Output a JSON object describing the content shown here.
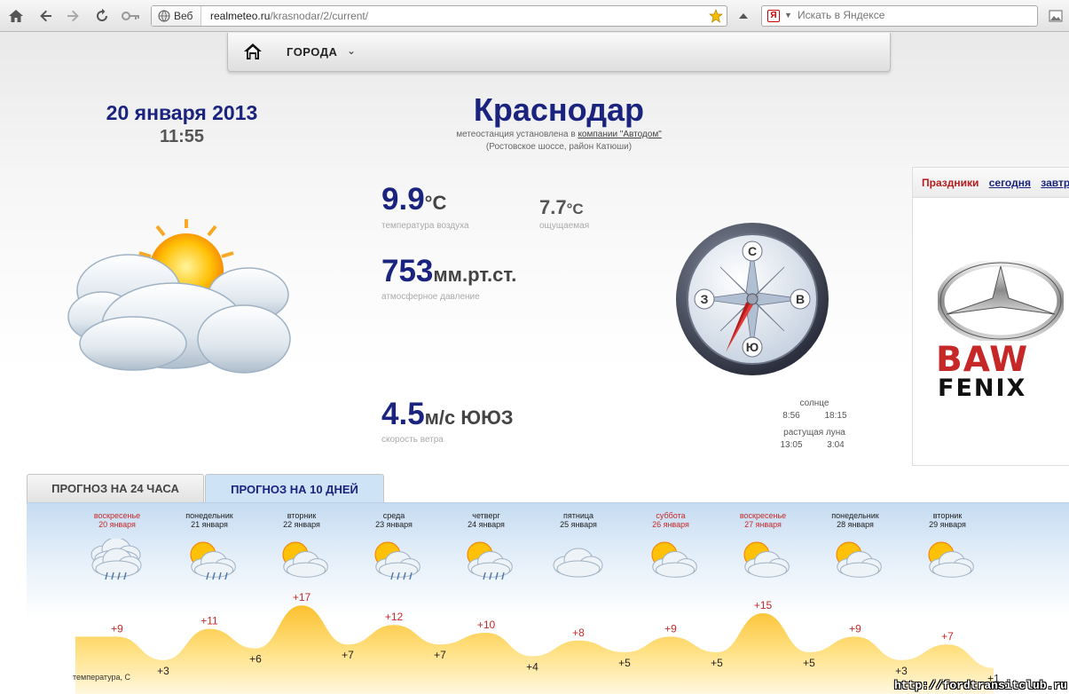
{
  "browser": {
    "identity_label": "Веб",
    "url_host": "realmeteo.ru",
    "url_path": "/krasnodar/2/current/",
    "search_placeholder": "Искать в Яндексе"
  },
  "nav": {
    "cities_label": "ГОРОДА"
  },
  "header": {
    "date": "20 января 2013",
    "time": "11:55",
    "city": "Краснодар",
    "station_prefix": "метеостанция установлена в",
    "station_link": "компании \"Автодом\"",
    "station_address": "(Ростовское шоссе, район Катюши)"
  },
  "current": {
    "temperature": "9.9",
    "temperature_unit": "°С",
    "temperature_caption": "температура воздуха",
    "feels": "7.7",
    "feels_unit": "°С",
    "feels_caption": "ощущаемая",
    "pressure": "753",
    "pressure_unit": "мм.рт.ст.",
    "pressure_caption": "атмосферное давление",
    "wind": "4.5",
    "wind_unit": "м/с ЮЮЗ",
    "wind_caption": "скорость ветра"
  },
  "compass": {
    "north": "С",
    "east": "В",
    "south": "Ю",
    "west": "З"
  },
  "astro": {
    "sun_label": "солнце",
    "sunrise": "8:56",
    "sunset": "18:15",
    "moon_label": "растущая луна",
    "moonrise": "13:05",
    "moonset": "3:04"
  },
  "holidays": {
    "title": "Праздники",
    "today_link": "сегодня",
    "tomorrow_link": "завтра"
  },
  "ad": {
    "brand": "BAW",
    "model": "FENIX"
  },
  "tabs": {
    "hours24": "ПРОГНОЗ НА 24 ЧАСА",
    "days10": "ПРОГНОЗ НА 10 ДНЕЙ"
  },
  "forecast": {
    "days": [
      {
        "weekday": "воскресенье",
        "date": "20 января",
        "holiday": true,
        "icon": "cloud-rain-icon",
        "day_temp": "+9",
        "night_temp": "+3"
      },
      {
        "weekday": "понедельник",
        "date": "21 января",
        "holiday": false,
        "icon": "sun-cloud-rain-icon",
        "day_temp": "+11",
        "night_temp": "+6"
      },
      {
        "weekday": "вторник",
        "date": "22 января",
        "holiday": false,
        "icon": "sun-cloud-icon",
        "day_temp": "+17",
        "night_temp": "+7"
      },
      {
        "weekday": "среда",
        "date": "23 января",
        "holiday": false,
        "icon": "sun-cloud-rain-icon",
        "day_temp": "+12",
        "night_temp": "+7"
      },
      {
        "weekday": "четверг",
        "date": "24 января",
        "holiday": false,
        "icon": "sun-cloud-rain-icon",
        "day_temp": "+10",
        "night_temp": "+4"
      },
      {
        "weekday": "пятница",
        "date": "25 января",
        "holiday": false,
        "icon": "cloud-icon",
        "day_temp": "+8",
        "night_temp": "+5"
      },
      {
        "weekday": "суббота",
        "date": "26 января",
        "holiday": true,
        "icon": "sun-cloud-icon",
        "day_temp": "+9",
        "night_temp": "+5"
      },
      {
        "weekday": "воскресенье",
        "date": "27 января",
        "holiday": true,
        "icon": "sun-cloud-icon",
        "day_temp": "+15",
        "night_temp": "+5"
      },
      {
        "weekday": "понедельник",
        "date": "28 января",
        "holiday": false,
        "icon": "sun-cloud-icon",
        "day_temp": "+9",
        "night_temp": "+3"
      },
      {
        "weekday": "вторник",
        "date": "29 января",
        "holiday": false,
        "icon": "sun-cloud-icon",
        "day_temp": "+7",
        "night_temp": "+1"
      }
    ],
    "temp_axis_label": "температура, С"
  },
  "watermark": "http://fordtransitclub.ru",
  "colors": {
    "title_blue": "#1a237e",
    "holiday_red": "#c62828",
    "temp_fill": "#ffd54f"
  }
}
